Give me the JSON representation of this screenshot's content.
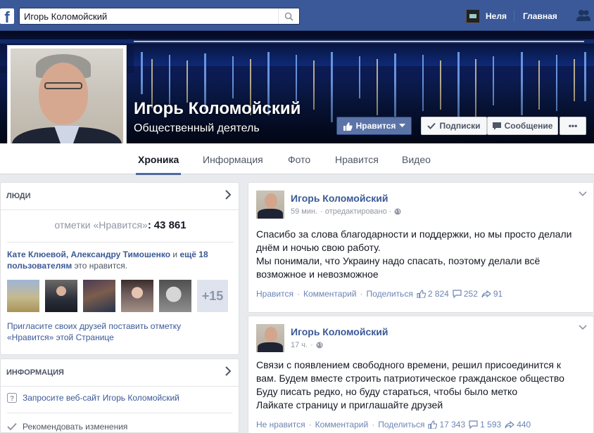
{
  "topbar": {
    "logo": "f",
    "search_value": "Игорь Коломойский",
    "user_name": "Неля",
    "home_label": "Главная"
  },
  "page": {
    "name": "Игорь Коломойский",
    "category": "Общественный деятель",
    "buttons": {
      "like": "Нравится",
      "subscriptions": "Подписки",
      "message": "Сообщение",
      "more": "•••"
    },
    "tabs": [
      "Хроника",
      "Информация",
      "Фото",
      "Нравится",
      "Видео"
    ]
  },
  "people_card": {
    "title": "ЛЮДИ",
    "likes_label": "отметки «Нравится»",
    "likes_colon": ":",
    "likes_count": "43 861",
    "friends_like": {
      "names": "Кате Клюевой, Александру Тимошенко",
      "and": " и ",
      "more": "ещё 18 пользователям",
      "suffix": " это нравится."
    },
    "more_count": "+15",
    "invite_text": "Пригласите своих друзей поставить отметку «Нравится» этой Странице"
  },
  "info_card": {
    "title": "ИНФОРМАЦИЯ",
    "website_request": "Запросите веб-сайт Игорь Коломойский",
    "suggest_edits": "Рекомендовать изменения"
  },
  "posts": [
    {
      "author": "Игорь Коломойский",
      "time": "59 мин.",
      "edited": "· отредактировано ·",
      "text_lines": [
        "Спасибо за слова благодарности и поддержки, но мы просто делали",
        "днём и ночью свою работу.",
        "Мы понимали, что Украину надо спасать, поэтому делали всё",
        "возможное и невозможное"
      ],
      "like_action": "Нравится",
      "comment_action": "Комментарий",
      "share_action": "Поделиться",
      "likes": "2 824",
      "comments": "252",
      "shares": "91"
    },
    {
      "author": "Игорь Коломойский",
      "time": "17 ч.",
      "edited": "·",
      "text_lines": [
        "Связи с появлением свободного времени, решил присоединится к",
        "вам. Будем вместе строить патриотическое гражданское общество",
        "Буду писать редко, но буду стараться, чтобы было метко",
        "Лайкате страницу и приглашайте друзей"
      ],
      "like_action": "Не нравится",
      "comment_action": "Комментарий",
      "share_action": "Поделиться",
      "likes": "17 343",
      "comments": "1 593",
      "shares": "440"
    }
  ],
  "colors": {
    "brand": "#3b5998",
    "link": "#3b5998",
    "muted": "#9197a3",
    "page_bg": "#e9eaed"
  }
}
